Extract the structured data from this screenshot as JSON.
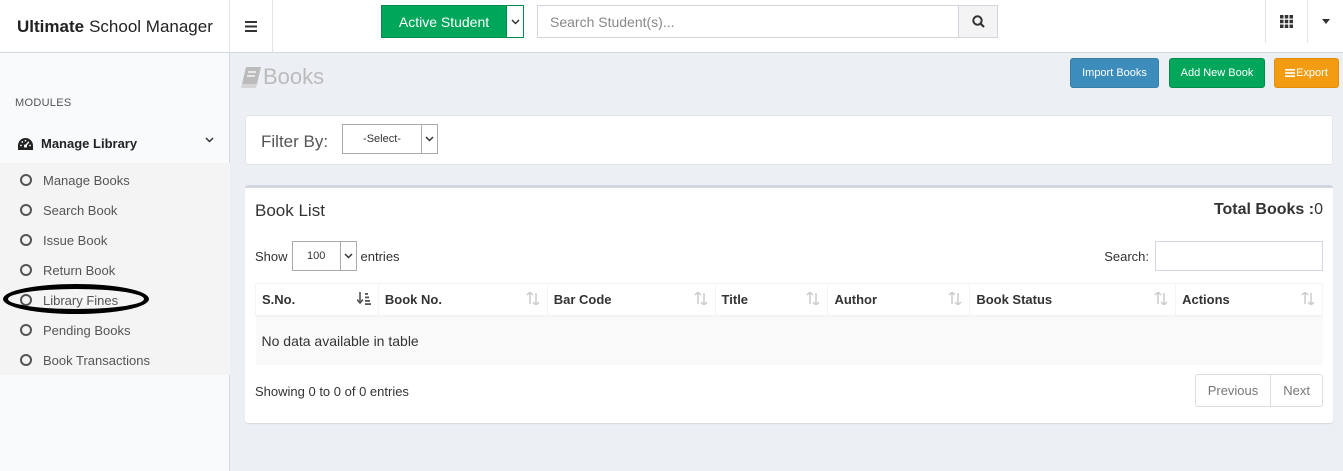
{
  "brand": {
    "bold": "Ultimate",
    "rest": "School Manager"
  },
  "header": {
    "active_student": "Active Student",
    "search_placeholder": "Search Student(s)..."
  },
  "sidebar": {
    "section_label": "MODULES",
    "menu_title": "Manage Library",
    "items": [
      "Manage Books",
      "Search Book",
      "Issue Book",
      "Return Book",
      "Library Fines",
      "Pending Books",
      "Book Transactions"
    ]
  },
  "page": {
    "title": "Books",
    "buttons": {
      "import": "Import Books",
      "add": "Add New Book",
      "export": "Export"
    }
  },
  "filter": {
    "label": "Filter By:",
    "selected": "-Select-"
  },
  "book_list": {
    "title": "Book List",
    "total_label": "Total Books :",
    "total_value": "0",
    "show_label": "Show",
    "page_length": "100",
    "entries_label": "entries",
    "search_label": "Search:",
    "columns": [
      "S.No.",
      "Book No.",
      "Bar Code",
      "Title",
      "Author",
      "Book Status",
      "Actions"
    ],
    "empty_text": "No data available in table",
    "info": "Showing 0 to 0 of 0 entries",
    "prev": "Previous",
    "next": "Next"
  },
  "colors": {
    "green": "#00a65a",
    "blue": "#3c8dbc",
    "orange": "#f39c12"
  }
}
